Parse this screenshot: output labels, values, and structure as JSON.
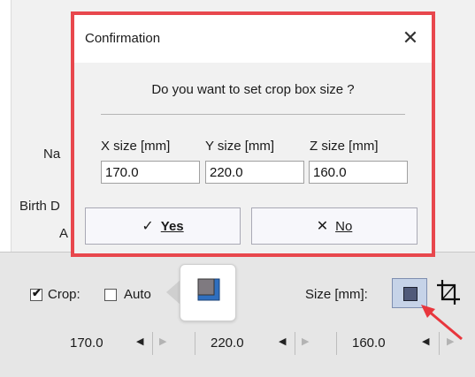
{
  "background": {
    "name_label": "Na",
    "birth_label": "Birth D",
    "a_label": "A"
  },
  "dialog": {
    "title": "Confirmation",
    "close_glyph": "✕",
    "question": "Do you want to set crop box size ?",
    "fields": [
      {
        "label": "X size [mm]",
        "value": "170.0"
      },
      {
        "label": "Y size [mm]",
        "value": "220.0"
      },
      {
        "label": "Z size [mm]",
        "value": "160.0"
      }
    ],
    "yes_glyph": "✓",
    "yes_label": "Yes",
    "no_glyph": "✕",
    "no_label": "No",
    "highlight_color": "#e8474d"
  },
  "controls": {
    "crop_label": "Crop:",
    "crop_checked": true,
    "auto_label": "Auto",
    "auto_checked": false,
    "size_label": "Size [mm]:",
    "crop_icon": "crop-icon",
    "values": [
      "170.0",
      "220.0",
      "160.0"
    ]
  }
}
